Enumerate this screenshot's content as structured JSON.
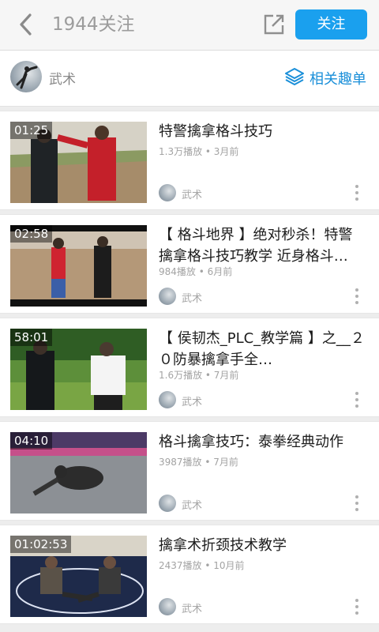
{
  "header": {
    "title": "1944关注",
    "follow_label": "关注"
  },
  "channel": {
    "name": "武术",
    "related_label": "相关趣单"
  },
  "videos": [
    {
      "duration": "01:25",
      "title": "特警擒拿格斗技巧",
      "meta": "1.3万播放 • 3月前",
      "author": "武术"
    },
    {
      "duration": "02:58",
      "title": "【 格斗地界 】绝对秒杀！特警擒拿格斗技巧教学 近身格斗…",
      "meta": "984播放 • 6月前",
      "author": "武术"
    },
    {
      "duration": "58:01",
      "title": "【 侯韧杰_PLC_教学篇 】之__２０防暴擒拿手全…",
      "meta": "1.6万播放 • 7月前",
      "author": "武术"
    },
    {
      "duration": "04:10",
      "title": "格斗擒拿技巧：泰拳经典动作",
      "meta": "3987播放 • 7月前",
      "author": "武术"
    },
    {
      "duration": "01:02:53",
      "title": "擒拿术折颈技术教学",
      "meta": "2437播放 • 10月前",
      "author": "武术"
    }
  ],
  "colors": {
    "accent": "#1aa0ee",
    "link": "#1a8fd9"
  }
}
